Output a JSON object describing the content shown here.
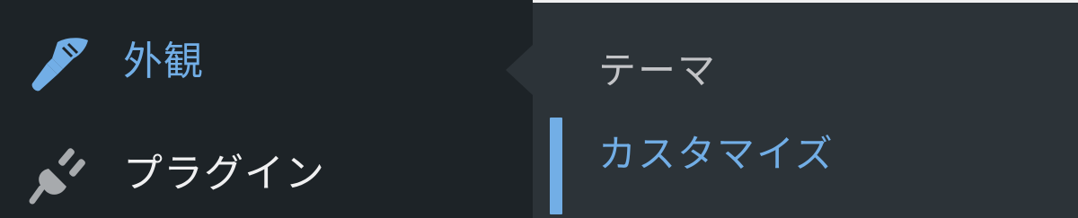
{
  "menu": {
    "items": [
      {
        "label": "外観",
        "icon": "paintbrush-icon",
        "state": "open"
      },
      {
        "label": "プラグイン",
        "icon": "plugin-icon",
        "state": "default"
      }
    ]
  },
  "submenu": {
    "items": [
      {
        "label": "テーマ",
        "state": "default"
      },
      {
        "label": "カスタマイズ",
        "state": "active"
      }
    ]
  },
  "colors": {
    "sidebar_bg": "#1d2327",
    "submenu_bg": "#2c3338",
    "accent": "#72aee6",
    "text_light": "#f0f0f1",
    "text_muted": "#c3c4c7",
    "icon_gray": "#a7aaad"
  }
}
